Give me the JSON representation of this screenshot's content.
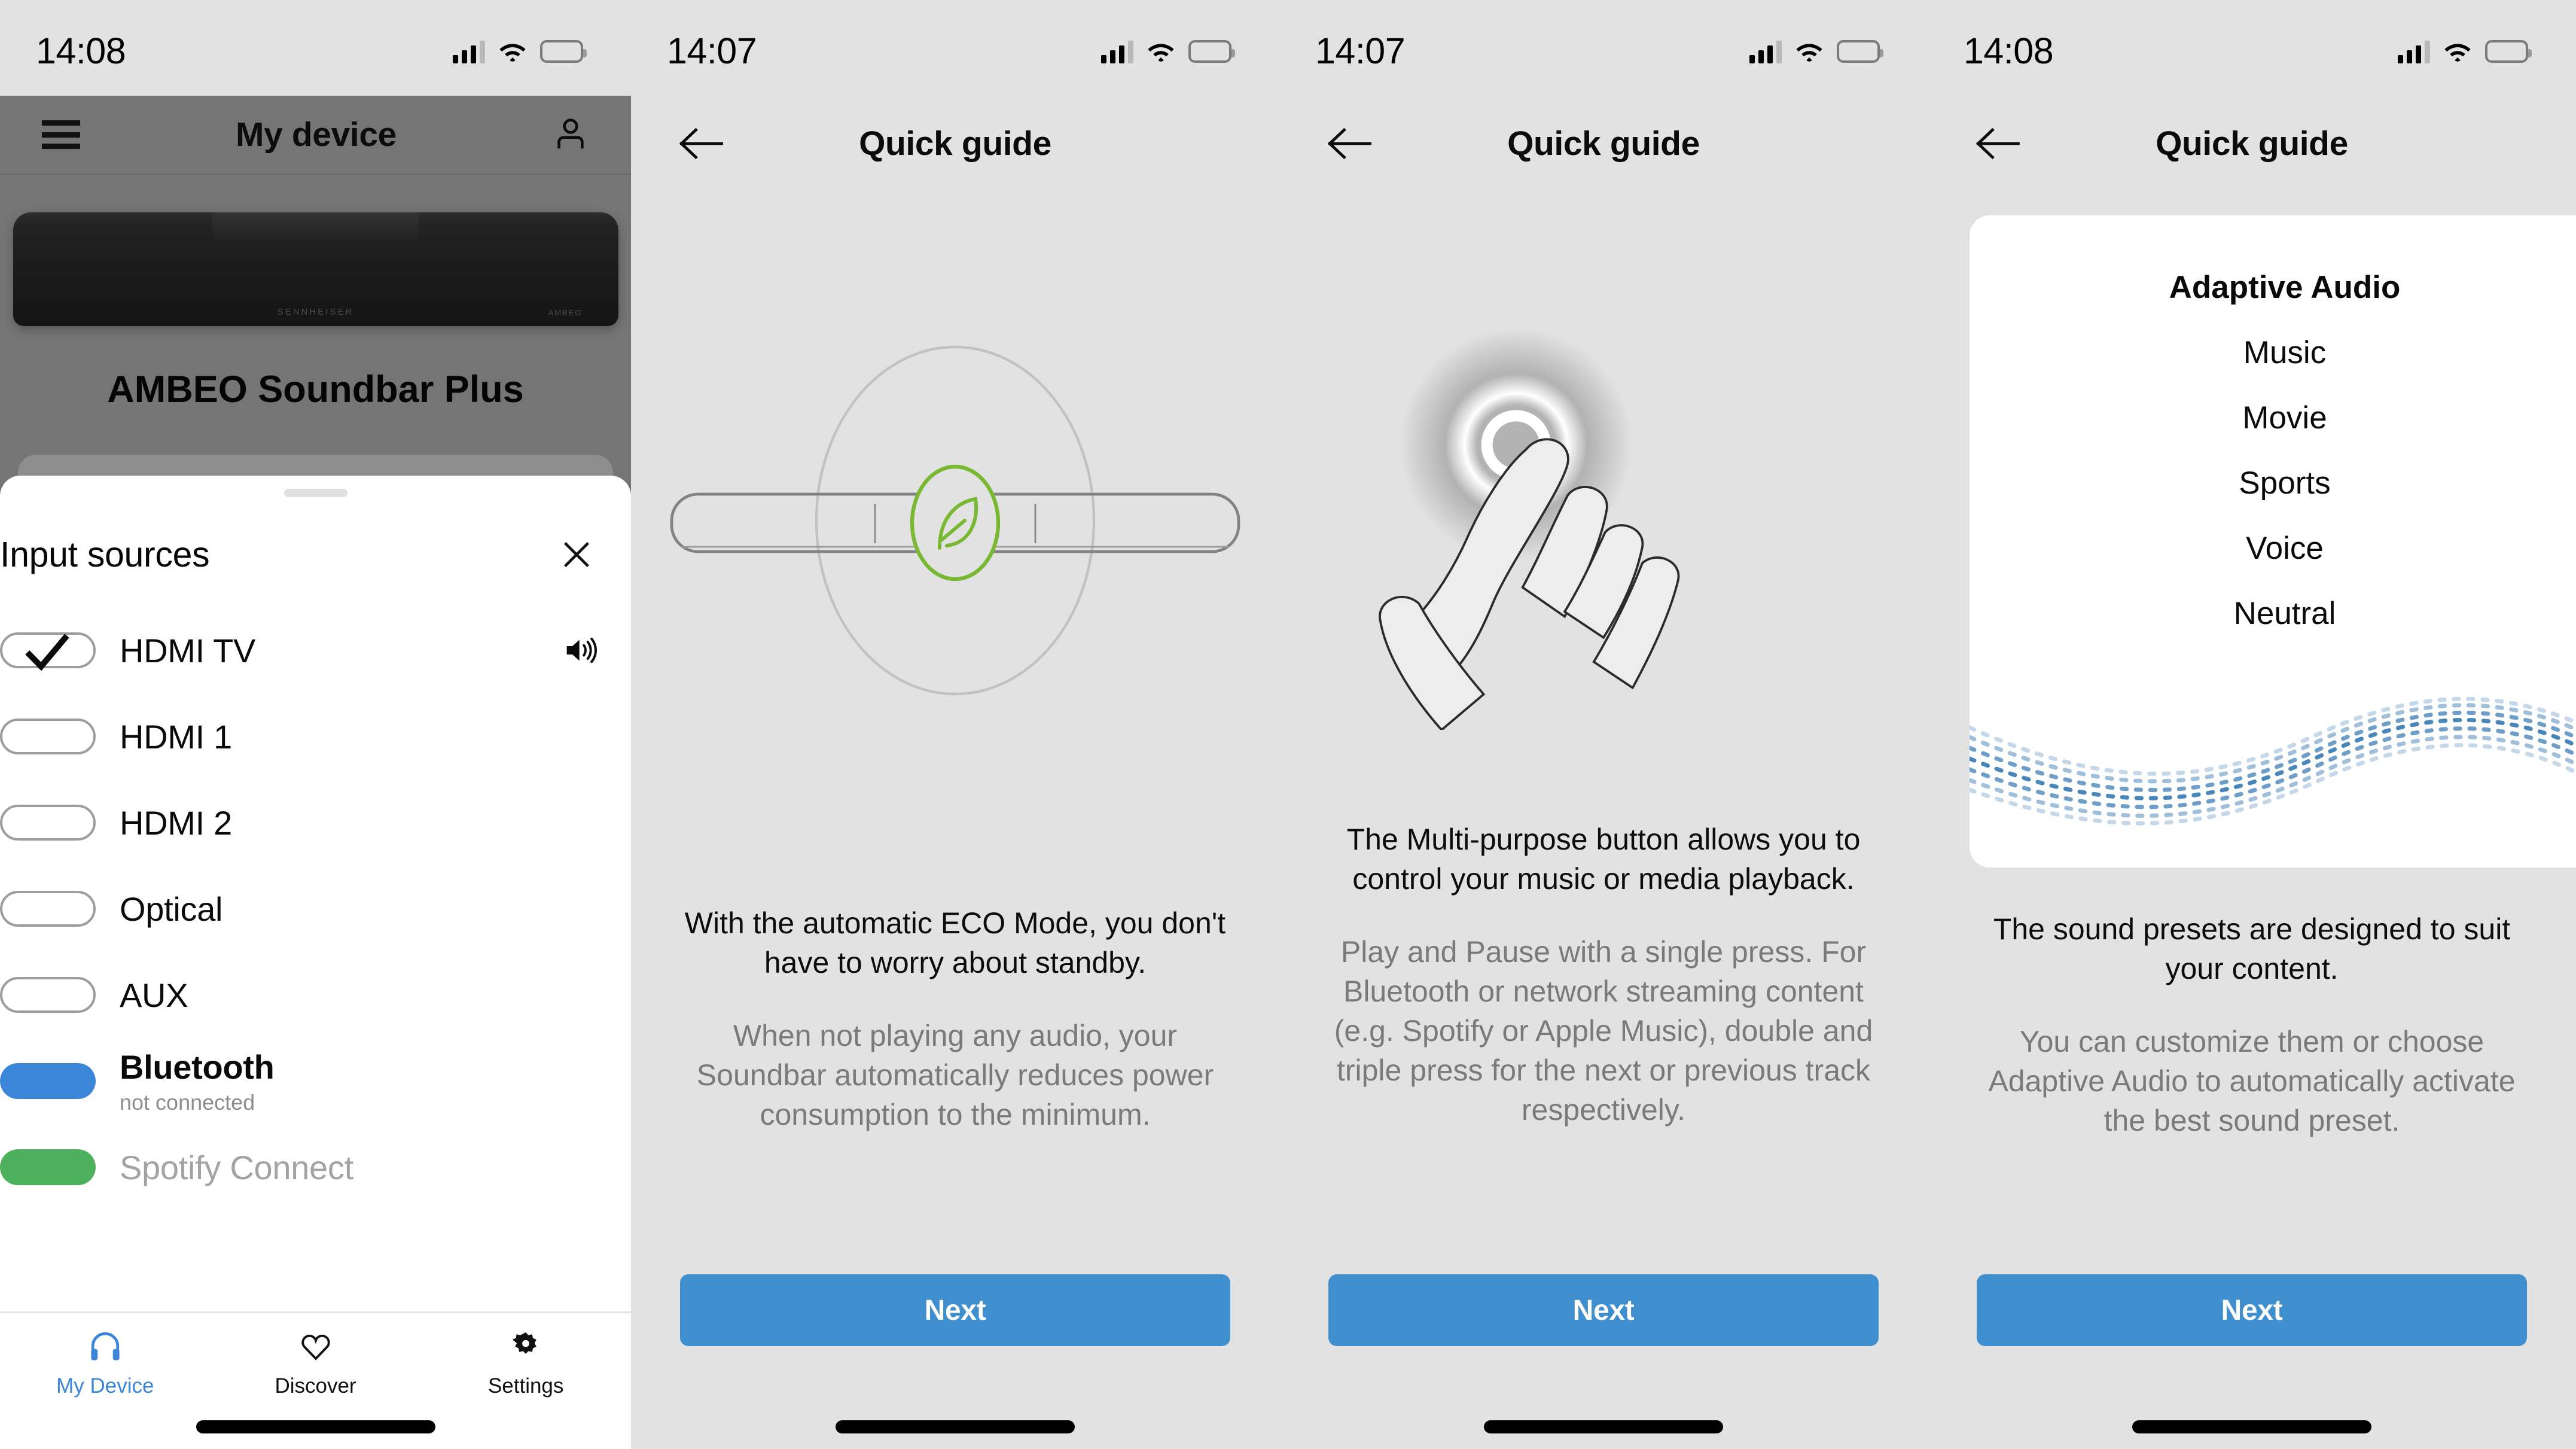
{
  "screens": [
    {
      "id": "my-device",
      "statusbar": {
        "time": "14:08"
      },
      "appbar": {
        "title": "My device"
      },
      "device": {
        "name": "AMBEO Soundbar Plus"
      },
      "sheet": {
        "title": "Input sources",
        "sources": [
          {
            "label": "HDMI TV",
            "state": "checked",
            "sub": "",
            "bold": false,
            "muted": false,
            "speaker": true
          },
          {
            "label": "HDMI 1",
            "state": "off",
            "sub": "",
            "bold": false,
            "muted": false,
            "speaker": false
          },
          {
            "label": "HDMI 2",
            "state": "off",
            "sub": "",
            "bold": false,
            "muted": false,
            "speaker": false
          },
          {
            "label": "Optical",
            "state": "off",
            "sub": "",
            "bold": false,
            "muted": false,
            "speaker": false
          },
          {
            "label": "AUX",
            "state": "off",
            "sub": "",
            "bold": false,
            "muted": false,
            "speaker": false
          },
          {
            "label": "Bluetooth",
            "state": "bluetooth",
            "sub": "not connected",
            "bold": true,
            "muted": false,
            "speaker": false
          },
          {
            "label": "Spotify Connect",
            "state": "spotify",
            "sub": "",
            "bold": false,
            "muted": true,
            "speaker": false
          }
        ]
      },
      "tabs": [
        {
          "label": "My Device",
          "icon": "headphones-icon",
          "active": true
        },
        {
          "label": "Discover",
          "icon": "heart-icon",
          "active": false
        },
        {
          "label": "Settings",
          "icon": "gear-icon",
          "active": false
        }
      ]
    },
    {
      "id": "quick-guide-eco",
      "statusbar": {
        "time": "14:07"
      },
      "title": "Quick guide",
      "lead": "With the automatic ECO Mode, you don't have to worry about standby.",
      "body": "When not playing any audio, your Soundbar automatically reduces power consumption to the minimum.",
      "next_label": "Next",
      "illustration": "soundbar-eco-leaf"
    },
    {
      "id": "quick-guide-multipurpose",
      "statusbar": {
        "time": "14:07"
      },
      "title": "Quick guide",
      "lead": "The Multi-purpose button allows you to control your music or media playback.",
      "body": "Play and Pause with a single press. For Bluetooth or network streaming content (e.g. Spotify or Apple Music), double and triple press for the next or previous track respectively.",
      "next_label": "Next",
      "illustration": "finger-press-button"
    },
    {
      "id": "quick-guide-presets",
      "statusbar": {
        "time": "14:08"
      },
      "title": "Quick guide",
      "presets": [
        "Adaptive Audio",
        "Music",
        "Movie",
        "Sports",
        "Voice",
        "Neutral"
      ],
      "lead": "The sound presets are designed to suit your content.",
      "body": "You can customize them or choose Adaptive Audio to automatically activate the best sound preset.",
      "next_label": "Next",
      "illustration": "sound-wave-dots"
    }
  ],
  "colors": {
    "accent_blue": "#3f8fcf",
    "bluetooth_blue": "#3b86d8",
    "spotify_green": "#4cb05d",
    "eco_green": "#78b833",
    "page_bg": "#e2e2e2",
    "device_bg": "#757575"
  }
}
